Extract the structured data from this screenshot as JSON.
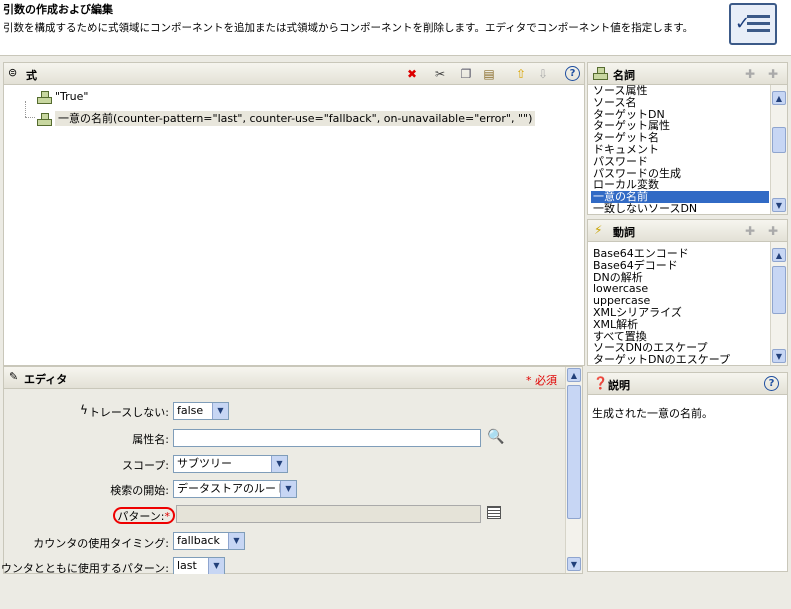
{
  "header": {
    "title": "引数の作成および編集",
    "description": "引数を構成するために式領域にコンポーネントを追加または式領域からコンポーネントを削除します。エディタでコンポーネント値を指定します。",
    "icon": "checklist-icon"
  },
  "expression": {
    "title": "式",
    "toolbar": [
      "delete-icon",
      "cut-icon",
      "copy-icon",
      "paste-icon",
      "move-up-icon",
      "move-down-icon",
      "help-icon"
    ],
    "nodes": [
      {
        "label": "\"True\""
      },
      {
        "label": "一意の名前(counter-pattern=\"last\", counter-use=\"fallback\", on-unavailable=\"error\", \"\")"
      }
    ]
  },
  "nouns": {
    "title": "名詞",
    "items": [
      "ソース属性",
      "ソース名",
      "ターゲットDN",
      "ターゲット属性",
      "ターゲット名",
      "ドキュメント",
      "パスワード",
      "パスワードの生成",
      "ローカル変数",
      "一意の名前",
      "一致しないソースDN"
    ],
    "selected": "一意の名前"
  },
  "verbs": {
    "title": "動詞",
    "items": [
      "Base64エンコード",
      "Base64デコード",
      "DNの解析",
      "lowercase",
      "uppercase",
      "XMLシリアライズ",
      "XML解析",
      "すべて置換",
      "ソースDNのエスケープ",
      "ターゲットDNのエスケープ"
    ]
  },
  "editor": {
    "title": "エディタ",
    "required_note": "* 必須",
    "fields": {
      "no_trace": {
        "label": "トレースしない:",
        "value": "false"
      },
      "attribute_name": {
        "label": "属性名:",
        "value": ""
      },
      "scope": {
        "label": "スコープ:",
        "value": "サブツリー"
      },
      "search_start": {
        "label": "検索の開始:",
        "value": "データストアのルート"
      },
      "pattern": {
        "label": "パターン:",
        "required_mark": "*",
        "value": ""
      },
      "counter_use": {
        "label": "カウンタの使用タイミング:",
        "value": "fallback"
      },
      "counter_pattern": {
        "label": "カウンタとともに使用するパターン:",
        "value": "last"
      }
    }
  },
  "description": {
    "title": "説明",
    "text": "生成された一意の名前。"
  },
  "colors": {
    "selection": "#316ac5",
    "required": "#e00000",
    "panel_bg": "#ecebe4"
  }
}
